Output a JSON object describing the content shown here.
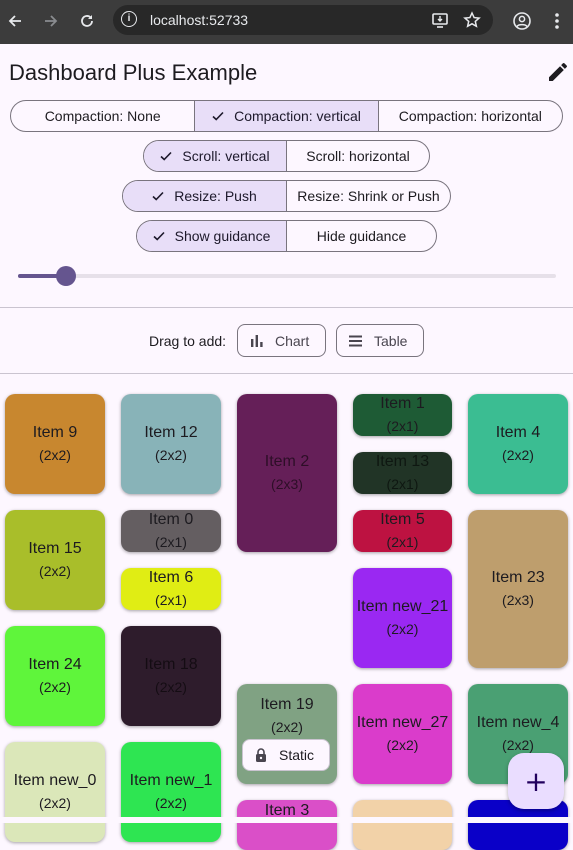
{
  "browser": {
    "url": "localhost:52733",
    "back_icon": "arrow-left-icon",
    "forward_icon": "arrow-right-icon",
    "reload_icon": "reload-icon"
  },
  "app": {
    "title": "Dashboard Plus Example"
  },
  "controls": {
    "compaction": [
      {
        "label": "Compaction: None",
        "selected": false
      },
      {
        "label": "Compaction: vertical",
        "selected": true
      },
      {
        "label": "Compaction: horizontal",
        "selected": false
      }
    ],
    "scroll": [
      {
        "label": "Scroll: vertical",
        "selected": true
      },
      {
        "label": "Scroll: horizontal",
        "selected": false
      }
    ],
    "resize": [
      {
        "label": "Resize: Push",
        "selected": true
      },
      {
        "label": "Resize: Shrink or Push",
        "selected": false
      }
    ],
    "guidance": [
      {
        "label": "Show guidance",
        "selected": true
      },
      {
        "label": "Hide guidance",
        "selected": false
      }
    ],
    "slider_value": 0.09
  },
  "drag_bar": {
    "label": "Drag to add:",
    "chart_label": "Chart",
    "table_label": "Table"
  },
  "tiles": [
    {
      "name": "Item 9",
      "size": "(2x2)",
      "color": "#c8872f"
    },
    {
      "name": "Item 12",
      "size": "(2x2)",
      "color": "#88b3b8"
    },
    {
      "name": "Item 2",
      "size": "(2x3)",
      "color": "#651f58"
    },
    {
      "name": "Item 1",
      "size": "(2x1)",
      "color": "#1e5b35"
    },
    {
      "name": "Item 4",
      "size": "(2x2)",
      "color": "#3bbd92"
    },
    {
      "name": "Item 13",
      "size": "(2x1)",
      "color": "#213426"
    },
    {
      "name": "Item 0",
      "size": "(2x1)",
      "color": "#645e61"
    },
    {
      "name": "Item 5",
      "size": "(2x1)",
      "color": "#bd1241"
    },
    {
      "name": "Item 15",
      "size": "(2x2)",
      "color": "#a9be2a"
    },
    {
      "name": "Item 6",
      "size": "(2x1)",
      "color": "#e0ed14"
    },
    {
      "name": "Item 23",
      "size": "(2x3)",
      "color": "#be9e6d"
    },
    {
      "name": "Item new_21",
      "size": "(2x2)",
      "color": "#9a28f2"
    },
    {
      "name": "Item 24",
      "size": "(2x2)",
      "color": "#5ff53b"
    },
    {
      "name": "Item 18",
      "size": "(2x2)",
      "color": "#2e1c2c"
    },
    {
      "name": "Item 19",
      "size": "(2x2)",
      "color": "#80a283"
    },
    {
      "name": "Item new_27",
      "size": "(2x2)",
      "color": "#da3ccb"
    },
    {
      "name": "Item new_4",
      "size": "(2x2)",
      "color": "#4aa073"
    },
    {
      "name": "Item new_0",
      "size": "(2x2)",
      "color": "#dbe7b9"
    },
    {
      "name": "Item new_1",
      "size": "(2x2)",
      "color": "#2ee552"
    },
    {
      "name": "Item 3",
      "size": "",
      "color": "#da4fc8"
    },
    {
      "name": "",
      "size": "",
      "color": "#f2d2a8"
    },
    {
      "name": "",
      "size": "",
      "color": "#0a00c8"
    }
  ],
  "static_chip": {
    "label": "Static",
    "icon": "lock-icon"
  },
  "fab": {
    "icon": "plus-icon",
    "glyph": "+"
  }
}
